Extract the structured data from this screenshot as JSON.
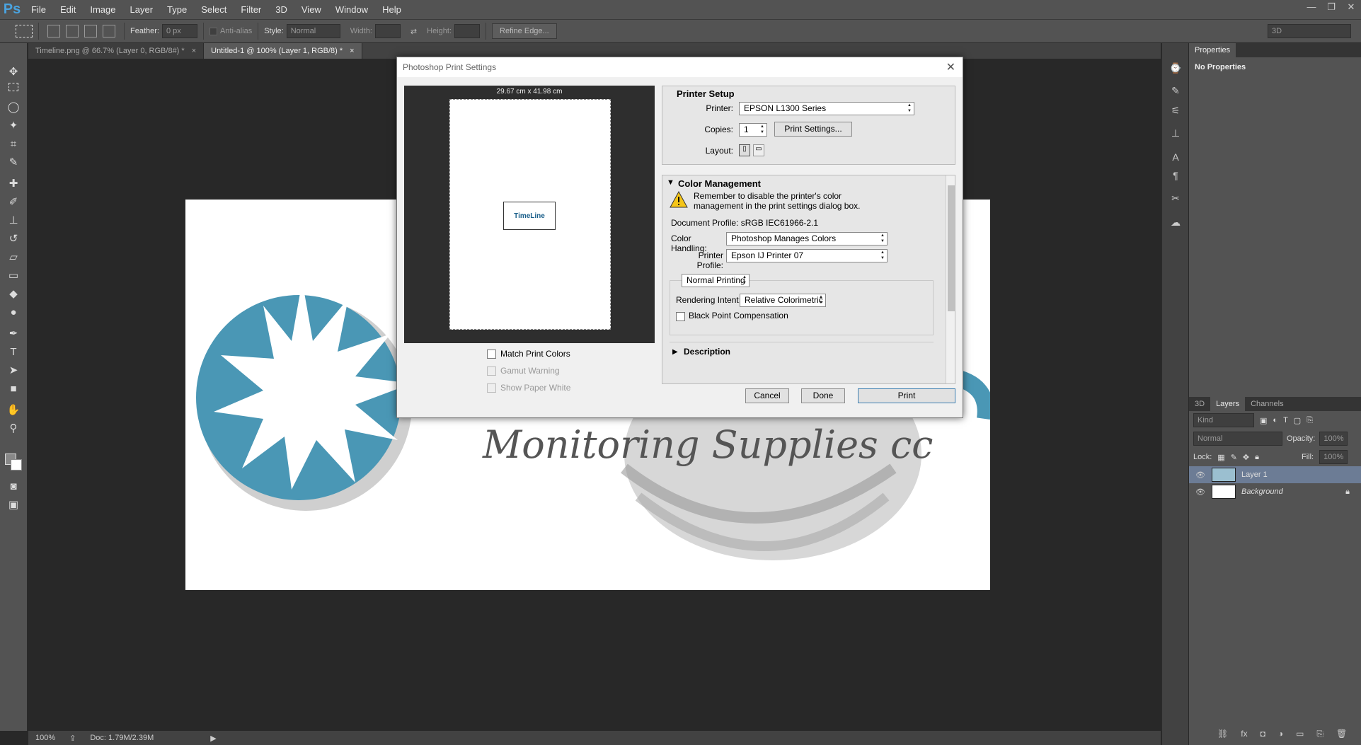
{
  "app": {
    "logo": "Ps"
  },
  "menu": [
    "File",
    "Edit",
    "Image",
    "Layer",
    "Type",
    "Select",
    "Filter",
    "3D",
    "View",
    "Window",
    "Help"
  ],
  "window_controls": [
    "—",
    "❐",
    "✕"
  ],
  "options_bar": {
    "feather_label": "Feather:",
    "feather_value": "0 px",
    "anti_alias": "Anti-alias",
    "style_label": "Style:",
    "style_value": "Normal",
    "width_label": "Width:",
    "height_label": "Height:",
    "refine_edge": "Refine Edge...",
    "workspace": "3D"
  },
  "tabs": [
    {
      "label": "Timeline.png @ 66.7% (Layer 0, RGB/8#) *"
    },
    {
      "label": "Untitled-1 @ 100% (Layer 1, RGB/8) *"
    }
  ],
  "canvas": {
    "text": "Monitoring Supplies cc",
    "brand_color": "#4a97b5"
  },
  "status": {
    "zoom": "100%",
    "doc": "Doc: 1.79M/2.39M"
  },
  "properties": {
    "tab": "Properties",
    "body": "No Properties"
  },
  "layers_panel": {
    "tabs": [
      "3D",
      "Layers",
      "Channels"
    ],
    "kind": "Kind",
    "blend": "Normal",
    "opacity_label": "Opacity:",
    "opacity_value": "100%",
    "lock_label": "Lock:",
    "fill_label": "Fill:",
    "fill_value": "100%",
    "layers": [
      {
        "name": "Layer 1",
        "selected": true
      },
      {
        "name": "Background",
        "selected": false
      }
    ]
  },
  "dialog": {
    "title": "Photoshop Print Settings",
    "preview_dim": "29.67 cm x 41.98 cm",
    "thumb_text": "TimeLine",
    "match_print_colors": "Match Print Colors",
    "gamut_warning": "Gamut Warning",
    "show_paper_white": "Show Paper White",
    "printer_setup": {
      "title": "Printer Setup",
      "printer_label": "Printer:",
      "printer_value": "EPSON L1300 Series",
      "copies_label": "Copies:",
      "copies_value": "1",
      "print_settings": "Print Settings...",
      "layout_label": "Layout:"
    },
    "color_management": {
      "title": "Color Management",
      "warning_line1": "Remember to disable the printer's color",
      "warning_line2": "management in the print settings dialog box.",
      "doc_profile": "Document Profile: sRGB IEC61966-2.1",
      "handling_label": "Color Handling:",
      "handling_value": "Photoshop Manages Colors",
      "profile_label": "Printer Profile:",
      "profile_value": "Epson IJ Printer 07",
      "mode_value": "Normal Printing",
      "intent_label": "Rendering Intent:",
      "intent_value": "Relative Colorimetric",
      "bpc": "Black Point Compensation",
      "description": "Description"
    },
    "buttons": {
      "cancel": "Cancel",
      "done": "Done",
      "print": "Print"
    }
  }
}
